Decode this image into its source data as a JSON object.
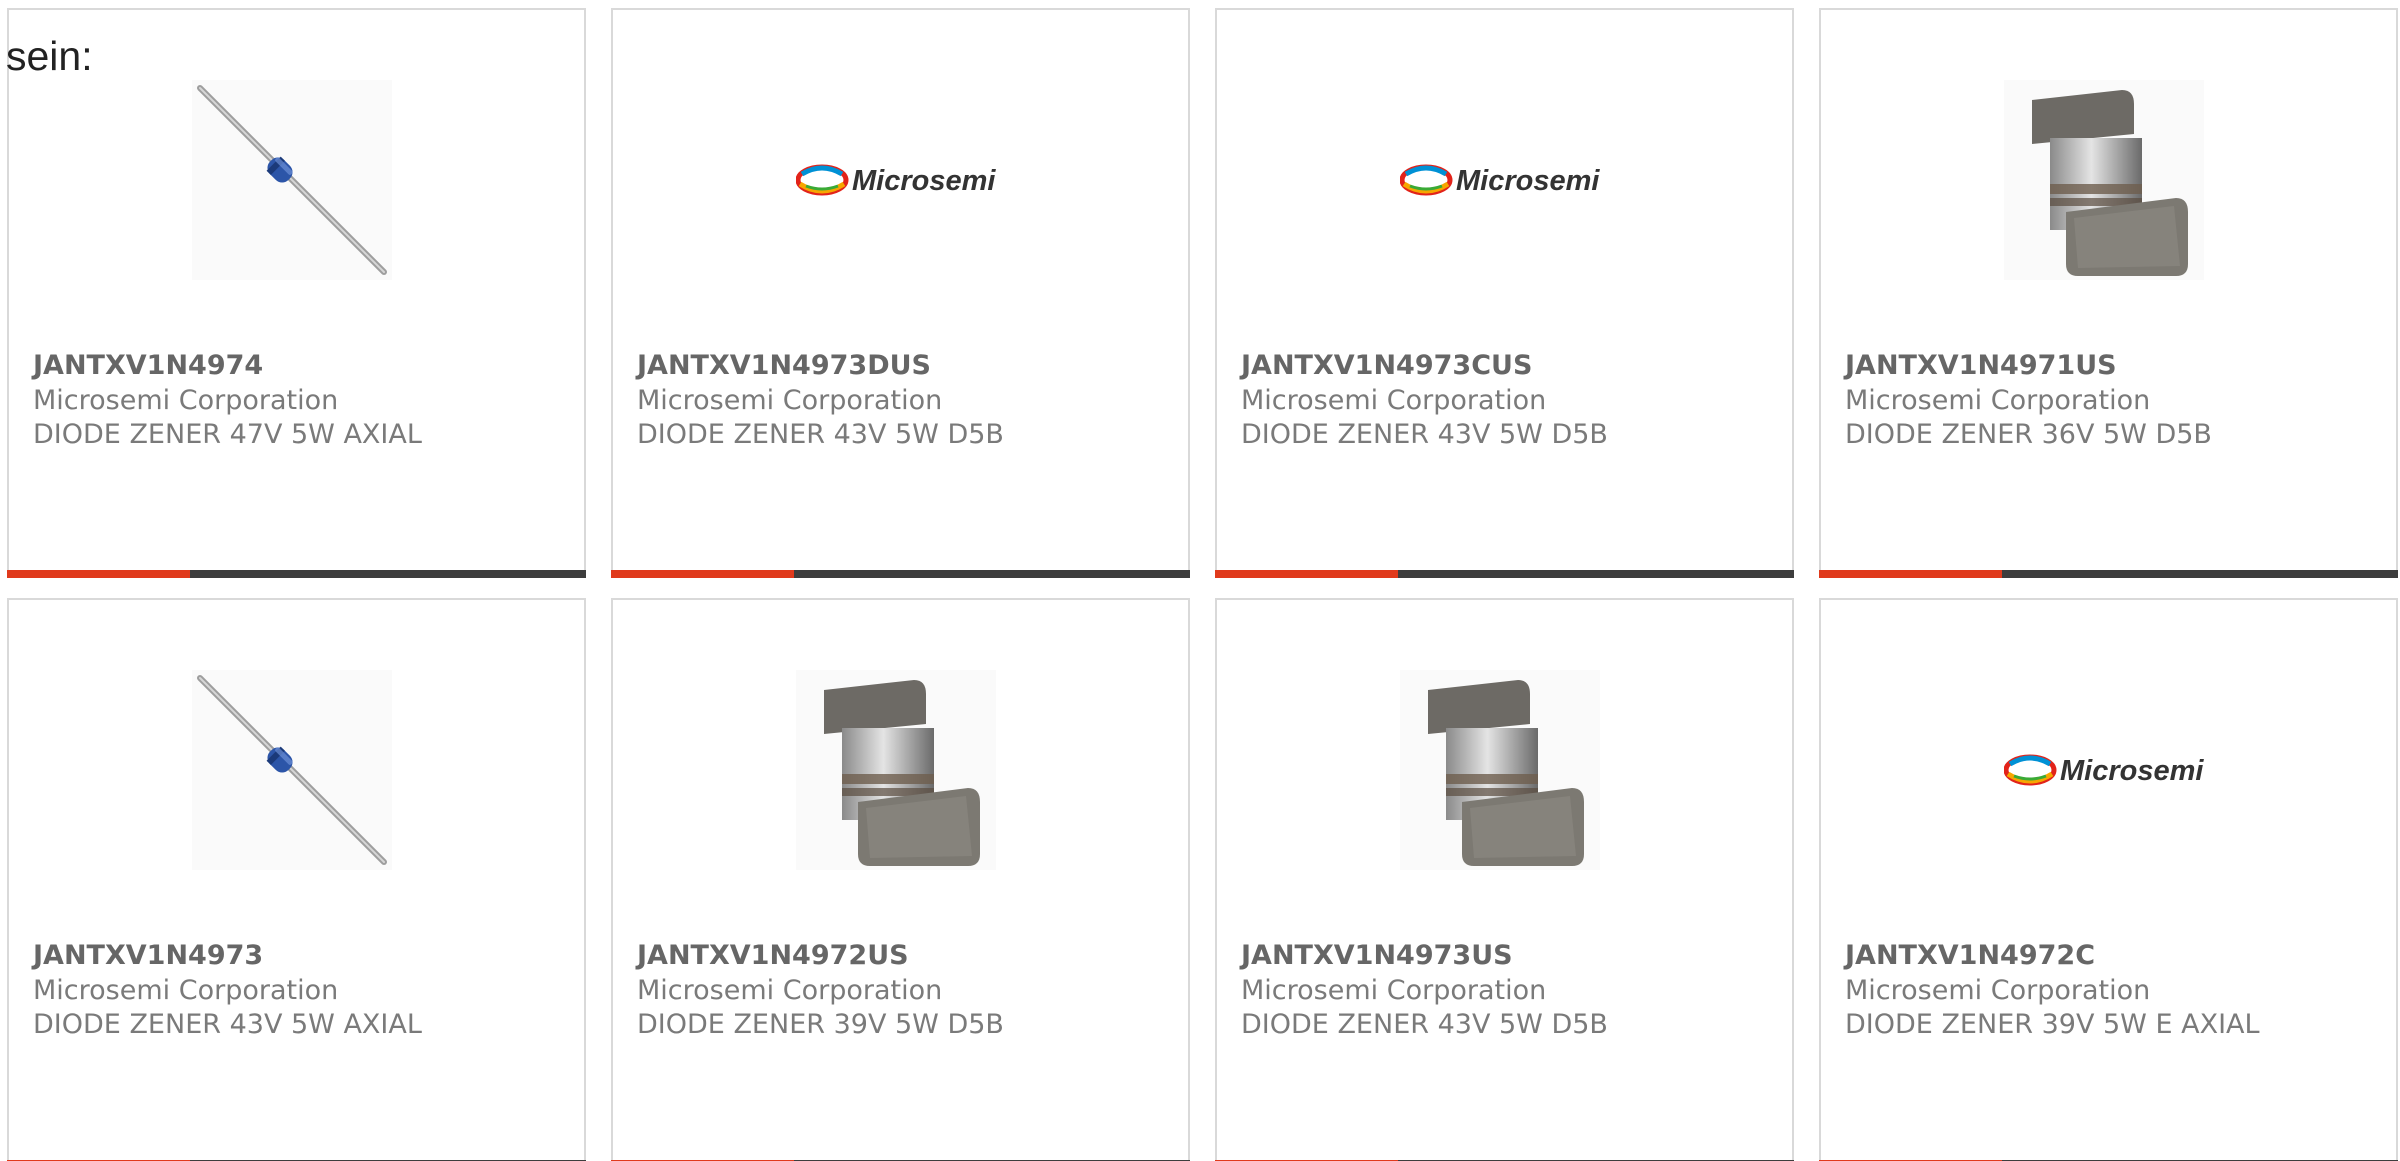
{
  "intro_text": "sein:",
  "colors": {
    "accent": "#e03a1c",
    "bar": "#3d3d3d",
    "border": "#d9d9d9"
  },
  "products": [
    {
      "part": "JANTXV1N4974",
      "manufacturer": "Microsemi Corporation",
      "description": "DIODE ZENER 47V 5W AXIAL",
      "image": "axial-diode-icon"
    },
    {
      "part": "JANTXV1N4973DUS",
      "manufacturer": "Microsemi Corporation",
      "description": "DIODE ZENER 43V 5W D5B",
      "image": "microsemi-logo",
      "logo_text": "Microsemi"
    },
    {
      "part": "JANTXV1N4973CUS",
      "manufacturer": "Microsemi Corporation",
      "description": "DIODE ZENER 43V 5W D5B",
      "image": "microsemi-logo",
      "logo_text": "Microsemi"
    },
    {
      "part": "JANTXV1N4971US",
      "manufacturer": "Microsemi Corporation",
      "description": "DIODE ZENER 36V 5W D5B",
      "image": "smd-diode-icon"
    },
    {
      "part": "JANTXV1N4973",
      "manufacturer": "Microsemi Corporation",
      "description": "DIODE ZENER 43V 5W AXIAL",
      "image": "axial-diode-icon"
    },
    {
      "part": "JANTXV1N4972US",
      "manufacturer": "Microsemi Corporation",
      "description": "DIODE ZENER 39V 5W D5B",
      "image": "smd-diode-icon"
    },
    {
      "part": "JANTXV1N4973US",
      "manufacturer": "Microsemi Corporation",
      "description": "DIODE ZENER 43V 5W D5B",
      "image": "smd-diode-icon"
    },
    {
      "part": "JANTXV1N4972C",
      "manufacturer": "Microsemi Corporation",
      "description": "DIODE ZENER 39V 5W E AXIAL",
      "image": "microsemi-logo",
      "logo_text": "Microsemi"
    }
  ]
}
